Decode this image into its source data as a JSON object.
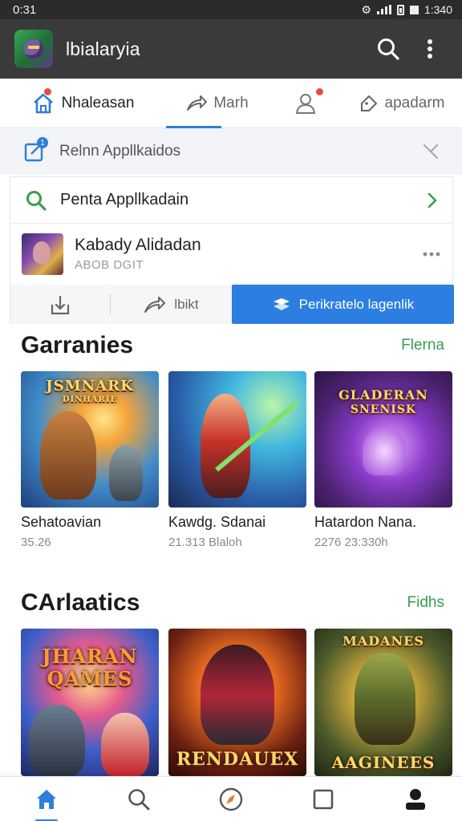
{
  "status_bar": {
    "time": "0:31",
    "right_text": "1:340"
  },
  "app_bar": {
    "title": "lbialaryia",
    "logo_icon": "game-logo-icon",
    "search_icon": "search-icon",
    "menu_icon": "more-vertical-icon"
  },
  "tabs": [
    {
      "label": "Nhaleasan",
      "icon": "home-icon",
      "badge": true,
      "active": true
    },
    {
      "label": "Marh",
      "icon": "share-icon",
      "badge": false,
      "active": false
    },
    {
      "label": "",
      "icon": "profile-icon",
      "badge": true,
      "active": false
    },
    {
      "label": "apadarm",
      "icon": "tag-icon",
      "badge": false,
      "active": false
    }
  ],
  "recent": {
    "label": "Relnn Appllkaidos",
    "icon": "edit-square-icon",
    "badge_count": "1"
  },
  "search_row": {
    "label": "Penta Appllkadain",
    "icon": "search-icon"
  },
  "game": {
    "name": "Kabady Alidadan",
    "subtitle": "ABOB DGIT"
  },
  "actions": {
    "second_label": "lbikt",
    "primary_label": "Perikratelo lagenlik"
  },
  "sections": [
    {
      "title": "Garranies",
      "link": "Flerna",
      "tiles": [
        {
          "art_title": "JSMNARK",
          "art_sub": "DINHARIE",
          "name": "Sehatoavian",
          "meta": "35.26"
        },
        {
          "art_title": "",
          "art_sub": "",
          "name": "Kawdg. Sdanai",
          "meta": "21.313 Blaloh"
        },
        {
          "art_title": "GLADERAN",
          "art_sub": "SNENISK",
          "name": "Hatardon Nana.",
          "meta": "2276 23:330h"
        }
      ]
    },
    {
      "title": "CArlaatics",
      "link": "Fidhs",
      "tiles": [
        {
          "art_title": "JHARAN",
          "art_sub": "QAMES",
          "name": "",
          "meta": ""
        },
        {
          "art_title": "RENDAUEX",
          "art_sub": "",
          "name": "",
          "meta": ""
        },
        {
          "art_title": "MADANES",
          "art_sub": "AAGINEES",
          "name": "",
          "meta": ""
        }
      ]
    }
  ],
  "bottom_nav": [
    {
      "icon": "home-icon",
      "active": true
    },
    {
      "icon": "search-icon",
      "active": false
    },
    {
      "icon": "compass-icon",
      "active": false
    },
    {
      "icon": "square-icon",
      "active": false
    },
    {
      "icon": "profile-icon",
      "active": false
    }
  ],
  "colors": {
    "accent_blue": "#2c7ee0",
    "link_green": "#3a9d4f",
    "badge_red": "#e94a4a",
    "app_bar": "#3a3a3a"
  }
}
